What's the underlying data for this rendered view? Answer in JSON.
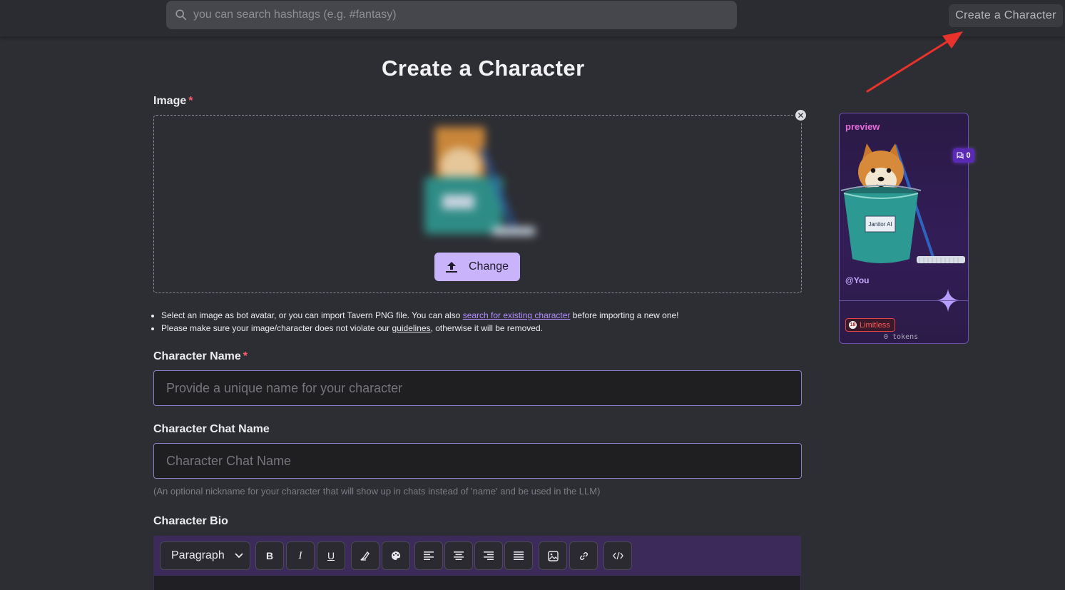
{
  "header": {
    "search_placeholder": "you can search hashtags (e.g. #fantasy)",
    "create_button": "Create a Character"
  },
  "page": {
    "title": "Create a Character"
  },
  "image_section": {
    "label": "Image",
    "required_mark": "*",
    "change_button": "Change",
    "notes": {
      "line1_pre": "Select an image as bot avatar, or you can import Tavern PNG file. You can also ",
      "line1_link": "search for existing character",
      "line1_post": " before importing a new one!",
      "line2_pre": "Please make sure your image/character does not violate our ",
      "line2_link": "guidelines",
      "line2_post": ", otherwise it will be removed."
    }
  },
  "character_name": {
    "label": "Character Name",
    "required_mark": "*",
    "placeholder": "Provide a unique name for your character",
    "value": ""
  },
  "character_chat_name": {
    "label": "Character Chat Name",
    "placeholder": "Character Chat Name",
    "value": "",
    "hint": "(An optional nickname for your character that will show up in chats instead of 'name' and be used in the LLM)"
  },
  "character_bio": {
    "label": "Character Bio",
    "toolbar": {
      "block_type": "Paragraph",
      "bold": "B",
      "italic": "I",
      "underline": "U"
    }
  },
  "preview_card": {
    "label": "preview",
    "chat_count": "0",
    "handle": "@You",
    "bucket_text": "Janitor AI",
    "badge_age": "18",
    "badge_label": "Limitless",
    "tokens": "0 tokens"
  },
  "colors": {
    "accent": "#c9b3fb",
    "background": "#2d2e33",
    "toolbar": "#3b2a5a",
    "required": "#ff5d6c",
    "annotation_arrow": "#e8322b"
  },
  "icons": [
    "search-icon",
    "upload-icon",
    "close-icon",
    "chevron-down-icon",
    "highlighter-icon",
    "palette-icon",
    "align-left-icon",
    "align-center-icon",
    "align-right-icon",
    "align-justify-icon",
    "image-icon",
    "link-icon",
    "code-icon",
    "chat-icon",
    "sparkle-icon"
  ]
}
